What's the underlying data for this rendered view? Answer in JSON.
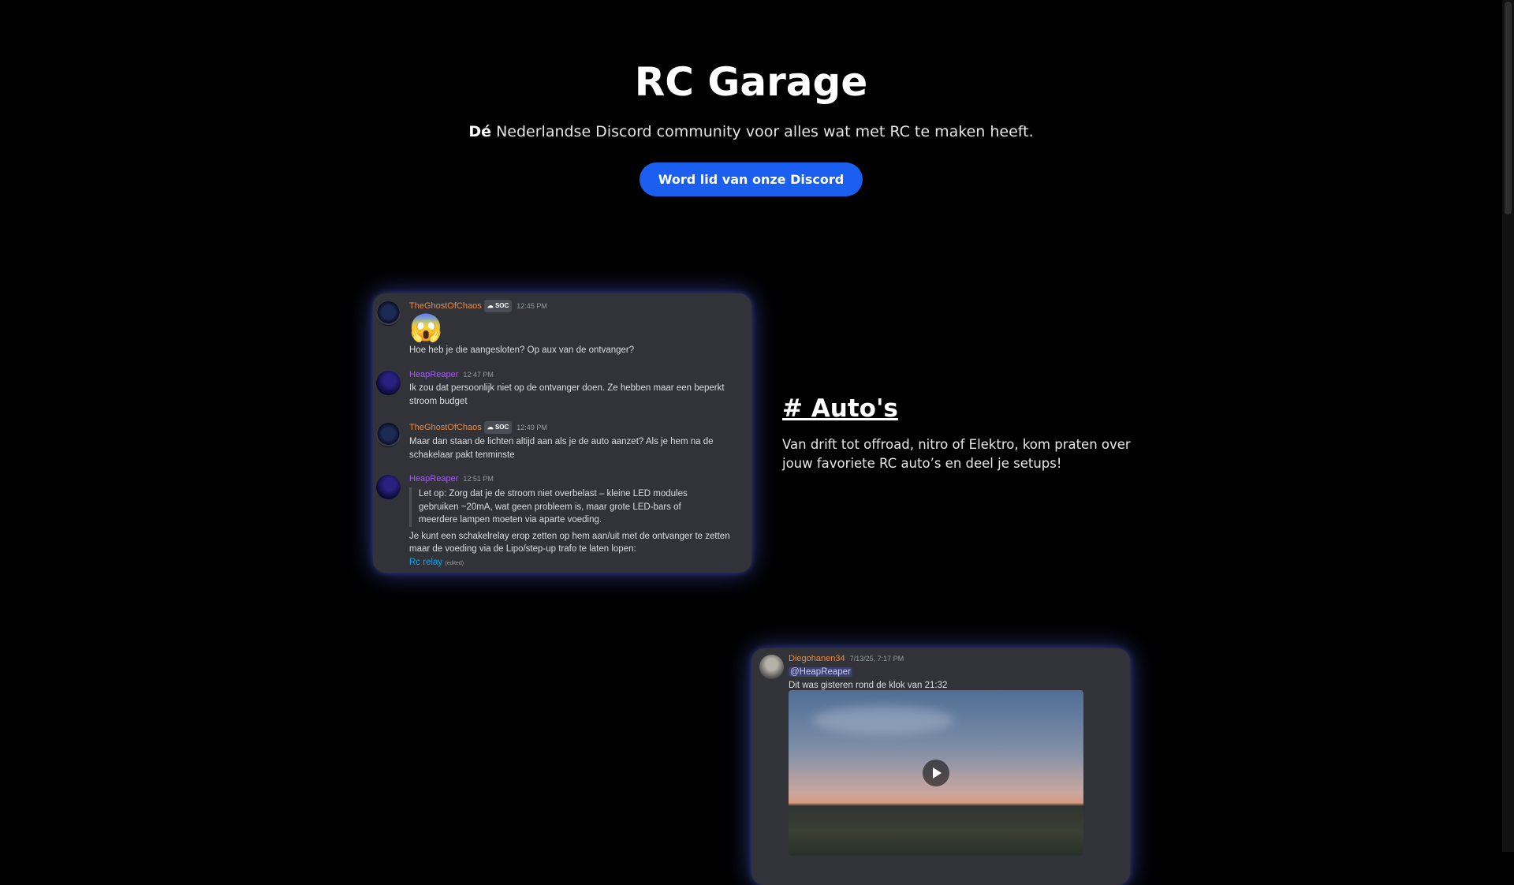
{
  "hero": {
    "title": "RC Garage",
    "tagline_bold": "Dé",
    "tagline_rest": " Nederlandse Discord community voor alles wat met RC te maken heeft.",
    "cta_label": "Word lid van onze Discord"
  },
  "colors": {
    "accent": "#1a5ff0",
    "card_bg": "#313338",
    "background": "#000000"
  },
  "chat1": {
    "messages": [
      {
        "author": "TheGhostOfChaos",
        "tag": "SOC",
        "time": "12:45 PM",
        "emoji": "😱",
        "text": "Hoe heb je die aangesloten? Op aux van de ontvanger?"
      },
      {
        "author": "HeapReaper",
        "time": "12:47 PM",
        "text": "Ik zou dat persoonlijk niet op de ontvanger doen. Ze hebben maar een beperkt stroom budget"
      },
      {
        "author": "TheGhostOfChaos",
        "tag": "SOC",
        "time": "12:49 PM",
        "text": "Maar dan staan de lichten altijd aan als je de auto aanzet? Als je hem na de schakelaar pakt tenminste"
      },
      {
        "author": "HeapReaper",
        "time": "12:51 PM",
        "quote": "Let op: Zorg dat je de stroom niet overbelast – kleine LED modules gebruiken ~20mA, wat geen probleem is, maar grote LED-bars of meerdere lampen moeten via aparte voeding.",
        "text": "Je kunt een schakelrelay erop zetten op hem aan/uit met de ontvanger te zetten maar de voeding via de Lipo/step-up trafo te laten lopen:",
        "link": "Rc relay",
        "edited": "(edited)"
      }
    ]
  },
  "feature": {
    "heading": "# Auto's",
    "description": "Van drift tot offroad, nitro of Elektro, kom praten over jouw favoriete RC auto’s en deel je setups!"
  },
  "chat2": {
    "author": "Diegohanen34",
    "time": "7/13/25, 7:17 PM",
    "mention": "@HeapReaper",
    "text": "Dit was gisteren rond de klok van 21:32"
  }
}
